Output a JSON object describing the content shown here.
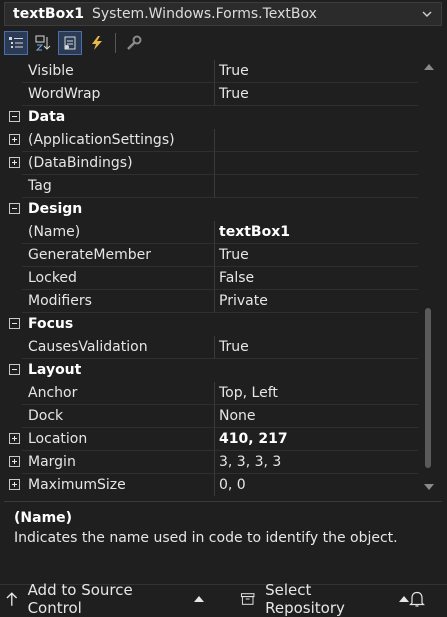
{
  "object_selector": {
    "name": "textBox1",
    "type": "System.Windows.Forms.TextBox"
  },
  "toolbar": {
    "buttons": [
      {
        "icon": "categorized-icon",
        "active": true
      },
      {
        "icon": "alphabetical-icon",
        "active": false
      },
      {
        "icon": "properties-icon",
        "active": true
      },
      {
        "icon": "events-icon",
        "active": false
      },
      {
        "icon": "property-pages-icon",
        "active": false
      }
    ]
  },
  "grid": {
    "rows": [
      {
        "kind": "prop",
        "name": "Visible",
        "value": "True"
      },
      {
        "kind": "prop",
        "name": "WordWrap",
        "value": "True"
      },
      {
        "kind": "cat",
        "name": "Data"
      },
      {
        "kind": "prop",
        "expander": "plus",
        "name": "(ApplicationSettings)",
        "value": ""
      },
      {
        "kind": "prop",
        "expander": "plus",
        "name": "(DataBindings)",
        "value": ""
      },
      {
        "kind": "prop",
        "name": "Tag",
        "value": ""
      },
      {
        "kind": "cat",
        "name": "Design"
      },
      {
        "kind": "prop",
        "name": "(Name)",
        "value": "textBox1",
        "bold": true
      },
      {
        "kind": "prop",
        "name": "GenerateMember",
        "value": "True"
      },
      {
        "kind": "prop",
        "name": "Locked",
        "value": "False"
      },
      {
        "kind": "prop",
        "name": "Modifiers",
        "value": "Private"
      },
      {
        "kind": "cat",
        "name": "Focus"
      },
      {
        "kind": "prop",
        "name": "CausesValidation",
        "value": "True"
      },
      {
        "kind": "cat",
        "name": "Layout"
      },
      {
        "kind": "prop",
        "name": "Anchor",
        "value": "Top, Left"
      },
      {
        "kind": "prop",
        "name": "Dock",
        "value": "None"
      },
      {
        "kind": "prop",
        "expander": "plus",
        "name": "Location",
        "value": "410, 217",
        "bold": true
      },
      {
        "kind": "prop",
        "expander": "plus",
        "name": "Margin",
        "value": "3, 3, 3, 3"
      },
      {
        "kind": "prop",
        "expander": "plus",
        "name": "MaximumSize",
        "value": "0, 0"
      }
    ]
  },
  "description": {
    "title": "(Name)",
    "text": "Indicates the name used in code to identify the object."
  },
  "status_bar": {
    "source_control": "Add to Source Control",
    "repository": "Select Repository"
  }
}
